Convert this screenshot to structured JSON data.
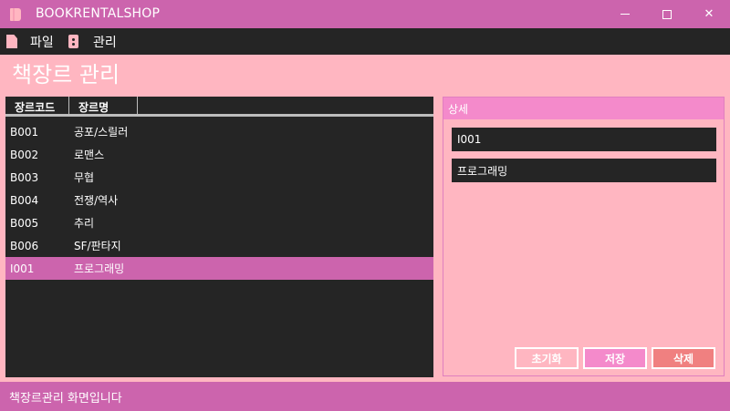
{
  "window": {
    "title": "BOOKRENTALSHOP",
    "minimize_glyph": "",
    "maximize_glyph": "",
    "close_glyph": "✕"
  },
  "menu": {
    "file_label": "파일",
    "manage_label": "관리",
    "file_icon": "file-icon",
    "manage_icon": "manage-icon"
  },
  "page": {
    "title": "책장르 관리"
  },
  "grid": {
    "columns": [
      "장르코드",
      "장르명"
    ],
    "rows": [
      {
        "code": "B001",
        "name": "공포/스릴러"
      },
      {
        "code": "B002",
        "name": "로맨스"
      },
      {
        "code": "B003",
        "name": "무협"
      },
      {
        "code": "B004",
        "name": "전쟁/역사"
      },
      {
        "code": "B005",
        "name": "추리"
      },
      {
        "code": "B006",
        "name": "SF/판타지"
      },
      {
        "code": "I001",
        "name": "프로그래밍"
      }
    ],
    "selected_index": 6
  },
  "detail": {
    "header": "상세",
    "code_value": "I001",
    "name_value": "프로그래밍",
    "reset_label": "초기화",
    "save_label": "저장",
    "delete_label": "삭제"
  },
  "status": {
    "text": "책장르관리 화면입니다"
  },
  "colors": {
    "titlebar": "#cc64ad",
    "background": "#ffb6c1",
    "dark": "#252525",
    "accent": "#f48acb",
    "delete": "#f08080"
  }
}
